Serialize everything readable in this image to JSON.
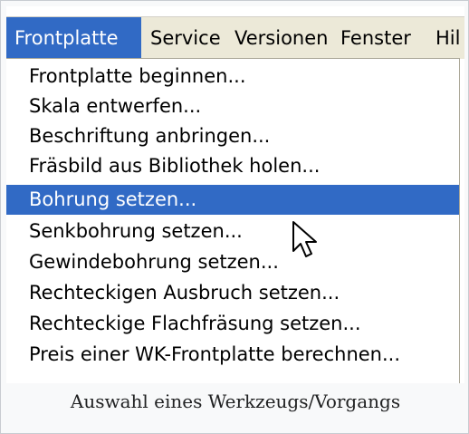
{
  "menubar": {
    "items": [
      {
        "label": "Frontplatte",
        "active": true
      },
      {
        "label": "Service"
      },
      {
        "label": "Versionen"
      },
      {
        "label": "Fenster"
      },
      {
        "label": "Hil"
      }
    ]
  },
  "menu": {
    "items": [
      {
        "label": "Frontplatte beginnen..."
      },
      {
        "label": "Skala entwerfen..."
      },
      {
        "label": "Beschriftung anbringen..."
      },
      {
        "label": "Fräsbild aus Bibliothek holen..."
      },
      {
        "label": "Bohrung setzen...",
        "highlighted": true
      },
      {
        "label": "Senkbohrung setzen..."
      },
      {
        "label": "Gewindebohrung setzen..."
      },
      {
        "label": "Rechteckigen Ausbruch setzen..."
      },
      {
        "label": "Rechteckige Flachfräsung setzen..."
      },
      {
        "label": "Preis einer WK-Frontplatte berechnen..."
      }
    ]
  },
  "caption": "Auswahl eines Werkzeugs/Vorgangs",
  "colors": {
    "highlight": "#316ac5",
    "menubar_background": "#ece9d8"
  },
  "icons": {
    "cursor": "mouse-pointer-icon"
  }
}
